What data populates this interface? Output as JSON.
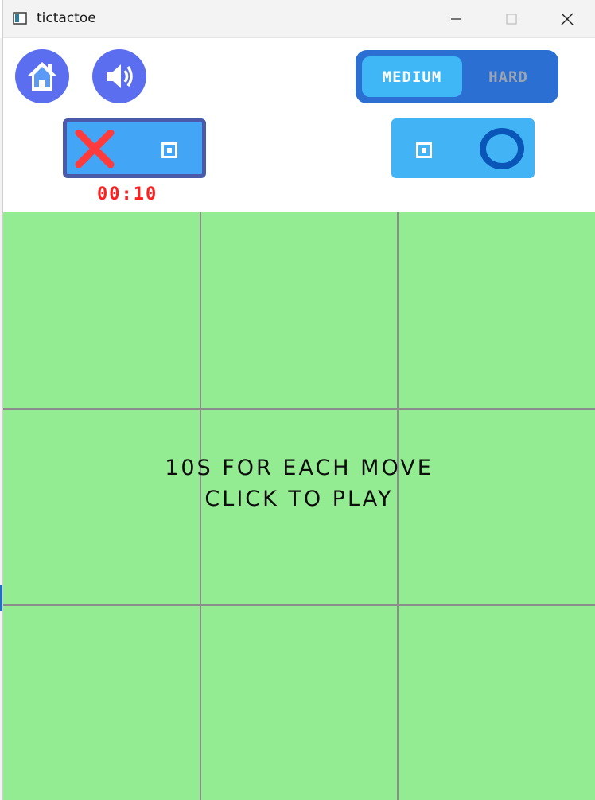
{
  "window": {
    "title": "tictactoe",
    "icon": "app-window-icon"
  },
  "toolbar": {
    "home_icon": "home-icon",
    "sound_icon": "speaker-icon",
    "difficulty": {
      "options": [
        "MEDIUM",
        "HARD"
      ],
      "selected": "MEDIUM"
    },
    "player_x": {
      "mark": "X",
      "mark_color": "#ff3b3b",
      "score": 0
    },
    "player_o": {
      "mark": "O",
      "mark_color": "#0a55b8",
      "score": 0
    },
    "timer": "00:10"
  },
  "board": {
    "cells": [
      "",
      "",
      "",
      "",
      "",
      "",
      "",
      "",
      ""
    ],
    "message_line1": "10S FOR EACH MOVE",
    "message_line2": "CLICK TO PLAY",
    "background": "#94ec92"
  }
}
